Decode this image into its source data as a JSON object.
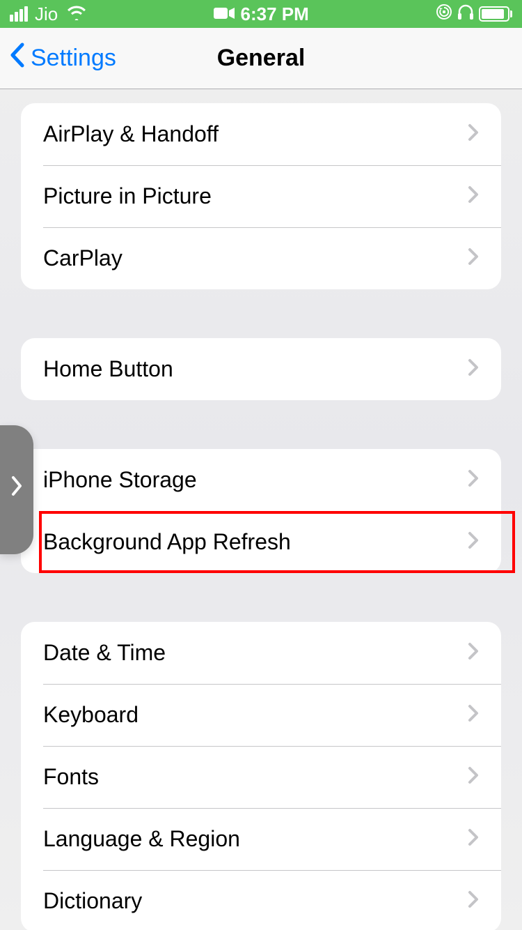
{
  "status_bar": {
    "carrier": "Jio",
    "time": "6:37 PM"
  },
  "nav": {
    "back_label": "Settings",
    "title": "General"
  },
  "groups": [
    {
      "id": "g1",
      "items": [
        {
          "id": "airplay",
          "label": "AirPlay & Handoff"
        },
        {
          "id": "pip",
          "label": "Picture in Picture"
        },
        {
          "id": "carplay",
          "label": "CarPlay"
        }
      ]
    },
    {
      "id": "g2",
      "items": [
        {
          "id": "homebtn",
          "label": "Home Button"
        }
      ]
    },
    {
      "id": "g3",
      "items": [
        {
          "id": "storage",
          "label": "iPhone Storage"
        },
        {
          "id": "bgrefresh",
          "label": "Background App Refresh",
          "highlighted": true
        }
      ]
    },
    {
      "id": "g4",
      "items": [
        {
          "id": "datetime",
          "label": "Date & Time"
        },
        {
          "id": "keyboard",
          "label": "Keyboard"
        },
        {
          "id": "fonts",
          "label": "Fonts"
        },
        {
          "id": "langregion",
          "label": "Language & Region"
        },
        {
          "id": "dictionary",
          "label": "Dictionary"
        }
      ]
    }
  ]
}
